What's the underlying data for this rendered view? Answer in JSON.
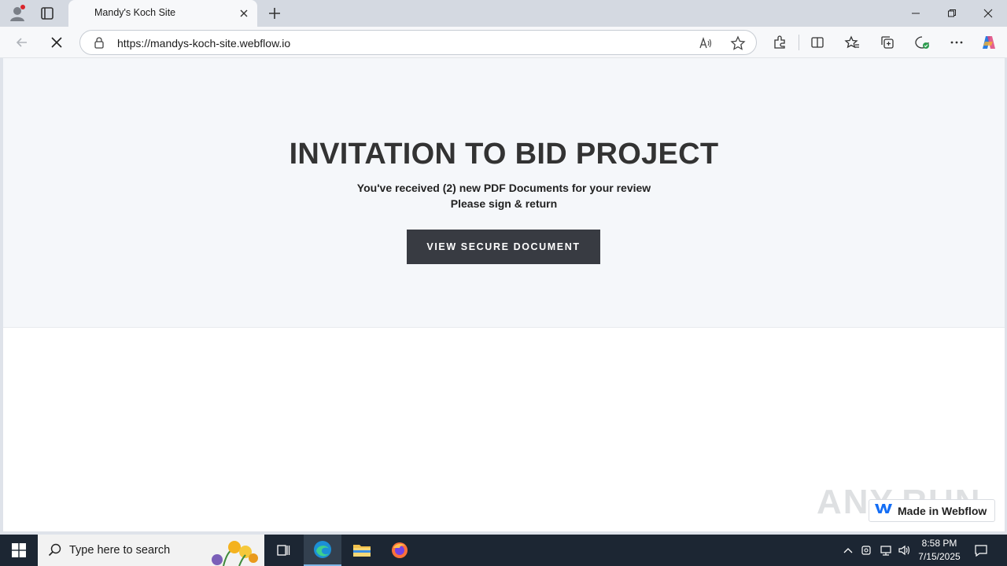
{
  "browser": {
    "tab_title": "Mandy's Koch Site",
    "url": "https://mandys-koch-site.webflow.io"
  },
  "page": {
    "heading": "INVITATION TO BID PROJECT",
    "line1": "You've received (2) new PDF Documents for your review",
    "line2": "Please sign & return",
    "cta_label": "VIEW SECURE DOCUMENT",
    "badge_text": "Made in Webflow",
    "watermark": "ANY.RUN"
  },
  "taskbar": {
    "search_placeholder": "Type here to search",
    "time": "8:58 PM",
    "date": "7/15/2025"
  },
  "colors": {
    "cta_bg": "#383b42",
    "hero_bg": "#f5f7fa",
    "taskbar_bg": "#1c2633"
  }
}
